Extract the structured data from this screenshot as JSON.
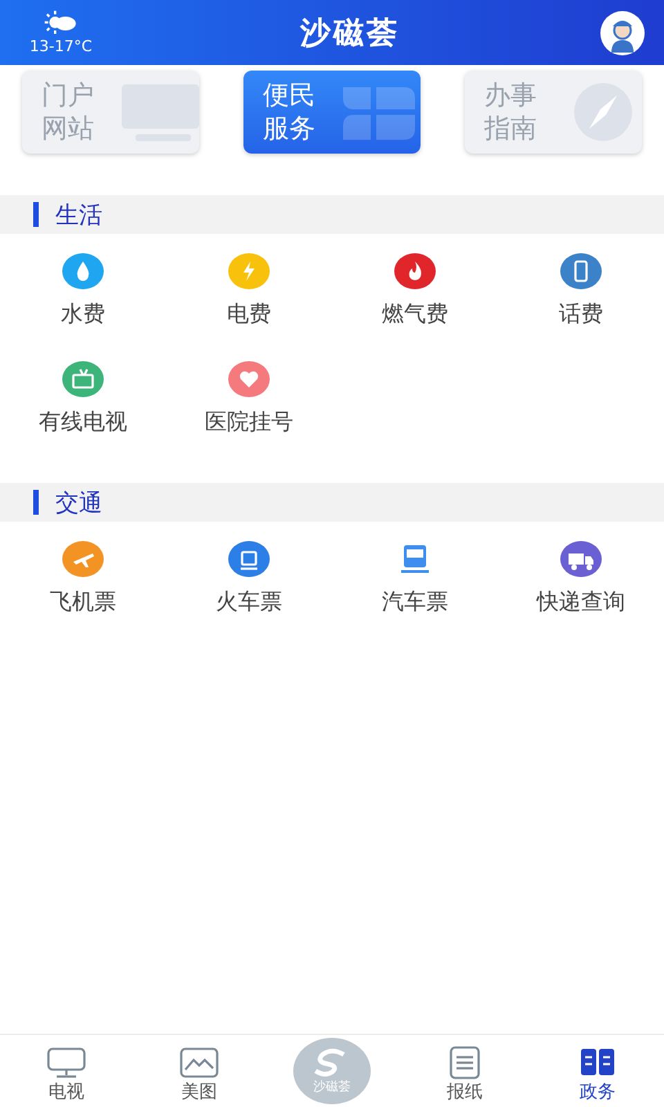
{
  "header": {
    "weather": "13-17°C",
    "title": "沙磁荟"
  },
  "tabs": [
    {
      "line1": "门户",
      "line2": "网站",
      "selected": false,
      "kind": "monitor"
    },
    {
      "line1": "便民",
      "line2": "服务",
      "selected": true,
      "kind": "clover"
    },
    {
      "line1": "办事",
      "line2": "指南",
      "selected": false,
      "kind": "compass"
    }
  ],
  "sections": [
    {
      "title": "生活",
      "items": [
        {
          "label": "水费",
          "kind": "drop",
          "color": "#1ea7f0"
        },
        {
          "label": "电费",
          "kind": "bolt",
          "color": "#f8c20c"
        },
        {
          "label": "燃气费",
          "kind": "flame",
          "color": "#e0262b"
        },
        {
          "label": "话费",
          "kind": "phone",
          "color": "#3b82c8"
        },
        {
          "label": "有线电视",
          "kind": "tv",
          "color": "#3db57a"
        },
        {
          "label": "医院挂号",
          "kind": "heart",
          "color": "#f47a7e"
        }
      ]
    },
    {
      "title": "交通",
      "items": [
        {
          "label": "飞机票",
          "kind": "plane",
          "color": "#f39324"
        },
        {
          "label": "火车票",
          "kind": "train",
          "color": "#2b7fe6"
        },
        {
          "label": "汽车票",
          "kind": "bus",
          "color": "#3e8ef0"
        },
        {
          "label": "快递查询",
          "kind": "truck",
          "color": "#6a60d4"
        }
      ]
    }
  ],
  "nav": [
    {
      "label": "电视",
      "kind": "tv",
      "selected": false
    },
    {
      "label": "美图",
      "kind": "image",
      "selected": false
    },
    {
      "label": "沙磁荟",
      "kind": "logo",
      "selected": false
    },
    {
      "label": "报纸",
      "kind": "paper",
      "selected": false
    },
    {
      "label": "政务",
      "kind": "book",
      "selected": true
    }
  ]
}
